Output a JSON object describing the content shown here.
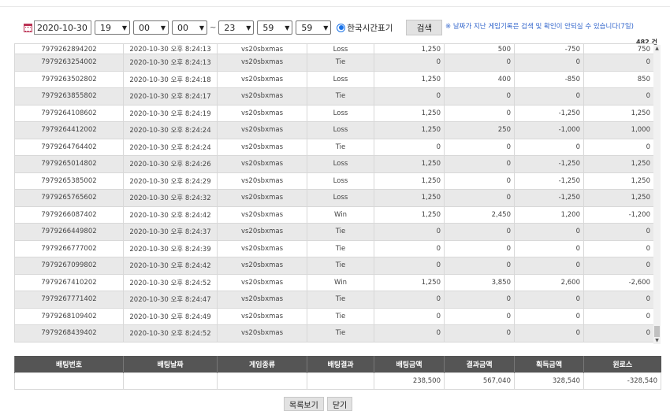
{
  "filter": {
    "date": "2020-10-30",
    "start_hour": "19",
    "start_min": "00",
    "start_sec": "00",
    "tilde": "~",
    "end_hour": "23",
    "end_min": "59",
    "end_sec": "59",
    "timezone_label": "한국시간표기",
    "search_label": "검색"
  },
  "notice": "※ 날짜가 지난 게임기록은 검색 및 확인이 안되실 수 있습니다(7일)",
  "record_count": "482 건",
  "rows": [
    [
      "7979262894202",
      "2020-10-30 오후 8:24:13",
      "vs20sbxmas",
      "Loss",
      "1,250",
      "500",
      "-750",
      "750"
    ],
    [
      "7979263254002",
      "2020-10-30 오후 8:24:13",
      "vs20sbxmas",
      "Tie",
      "0",
      "0",
      "0",
      "0"
    ],
    [
      "7979263502802",
      "2020-10-30 오후 8:24:18",
      "vs20sbxmas",
      "Loss",
      "1,250",
      "400",
      "-850",
      "850"
    ],
    [
      "7979263855802",
      "2020-10-30 오후 8:24:17",
      "vs20sbxmas",
      "Tie",
      "0",
      "0",
      "0",
      "0"
    ],
    [
      "7979264108602",
      "2020-10-30 오후 8:24:19",
      "vs20sbxmas",
      "Loss",
      "1,250",
      "0",
      "-1,250",
      "1,250"
    ],
    [
      "7979264412002",
      "2020-10-30 오후 8:24:24",
      "vs20sbxmas",
      "Loss",
      "1,250",
      "250",
      "-1,000",
      "1,000"
    ],
    [
      "7979264764402",
      "2020-10-30 오후 8:24:24",
      "vs20sbxmas",
      "Tie",
      "0",
      "0",
      "0",
      "0"
    ],
    [
      "7979265014802",
      "2020-10-30 오후 8:24:26",
      "vs20sbxmas",
      "Loss",
      "1,250",
      "0",
      "-1,250",
      "1,250"
    ],
    [
      "7979265385002",
      "2020-10-30 오후 8:24:29",
      "vs20sbxmas",
      "Loss",
      "1,250",
      "0",
      "-1,250",
      "1,250"
    ],
    [
      "7979265765602",
      "2020-10-30 오후 8:24:32",
      "vs20sbxmas",
      "Loss",
      "1,250",
      "0",
      "-1,250",
      "1,250"
    ],
    [
      "7979266087402",
      "2020-10-30 오후 8:24:42",
      "vs20sbxmas",
      "Win",
      "1,250",
      "2,450",
      "1,200",
      "-1,200"
    ],
    [
      "7979266449802",
      "2020-10-30 오후 8:24:37",
      "vs20sbxmas",
      "Tie",
      "0",
      "0",
      "0",
      "0"
    ],
    [
      "7979266777002",
      "2020-10-30 오후 8:24:39",
      "vs20sbxmas",
      "Tie",
      "0",
      "0",
      "0",
      "0"
    ],
    [
      "7979267099802",
      "2020-10-30 오후 8:24:42",
      "vs20sbxmas",
      "Tie",
      "0",
      "0",
      "0",
      "0"
    ],
    [
      "7979267410202",
      "2020-10-30 오후 8:24:52",
      "vs20sbxmas",
      "Win",
      "1,250",
      "3,850",
      "2,600",
      "-2,600"
    ],
    [
      "7979267771402",
      "2020-10-30 오후 8:24:47",
      "vs20sbxmas",
      "Tie",
      "0",
      "0",
      "0",
      "0"
    ],
    [
      "7979268109402",
      "2020-10-30 오후 8:24:49",
      "vs20sbxmas",
      "Tie",
      "0",
      "0",
      "0",
      "0"
    ],
    [
      "7979268439402",
      "2020-10-30 오후 8:24:52",
      "vs20sbxmas",
      "Tie",
      "0",
      "0",
      "0",
      "0"
    ]
  ],
  "summary": {
    "headers": [
      "배팅번호",
      "배팅날짜",
      "게임종류",
      "배팅결과",
      "배팅금액",
      "결과금액",
      "획득금액",
      "윈로스"
    ],
    "values": [
      "",
      "",
      "",
      "",
      "238,500",
      "567,040",
      "328,540",
      "-328,540"
    ]
  },
  "buttons": {
    "list_label": "목록보기",
    "close_label": "닫기"
  }
}
